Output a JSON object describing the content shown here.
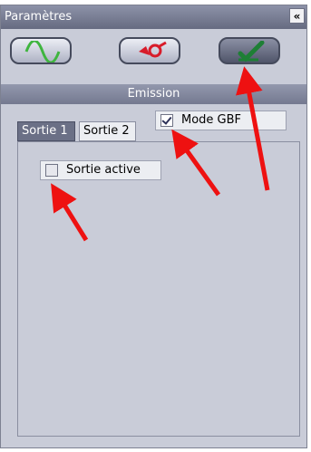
{
  "panel": {
    "title": "Paramètres",
    "collapse_label": "«"
  },
  "toolbar": {
    "buttons": [
      {
        "icon": "sine-wave-icon",
        "color": "#3fb53f"
      },
      {
        "icon": "probe-icon",
        "color": "#d81c2a"
      },
      {
        "icon": "check-icon",
        "color": "#1e7f35",
        "active": true
      }
    ]
  },
  "section": {
    "label": "Emission"
  },
  "tabs": [
    {
      "label": "Sortie 1",
      "active": true
    },
    {
      "label": "Sortie 2",
      "active": false
    }
  ],
  "mode_gbf": {
    "label": "Mode GBF",
    "checked": true
  },
  "sortie_active": {
    "label": "Sortie active",
    "checked": false
  },
  "annotations": {
    "arrow_color": "#ee1111"
  }
}
